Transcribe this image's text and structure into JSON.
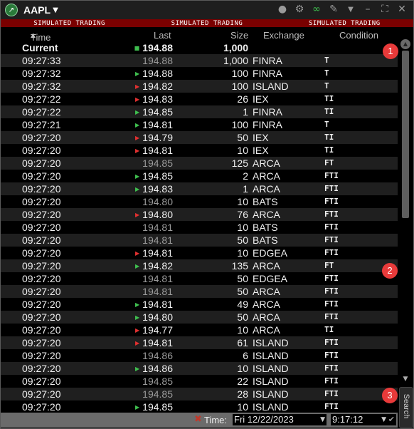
{
  "title": {
    "symbol": "AAPL",
    "app_icon": "tws-logo-icon"
  },
  "toolbar_icons": [
    "chat-icon",
    "gear-icon",
    "link-icon",
    "pin-icon",
    "caret-down-icon",
    "minimize-icon",
    "maximize-icon",
    "close-icon"
  ],
  "banner": [
    "SIMULATED TRADING",
    "SIMULATED TRADING",
    "SIMULATED TRADING"
  ],
  "columns": {
    "time": "Time",
    "last": "Last",
    "size": "Size",
    "exchange": "Exchange",
    "condition": "Condition"
  },
  "current": {
    "time": "Current",
    "last": "194.88",
    "size": "1,000"
  },
  "trades": [
    {
      "time": "09:27:33",
      "last": "194.88",
      "size": "1,000",
      "exchange": "FINRA",
      "condition": "T",
      "tick": "none"
    },
    {
      "time": "09:27:32",
      "last": "194.88",
      "size": "100",
      "exchange": "FINRA",
      "condition": "T",
      "tick": "up"
    },
    {
      "time": "09:27:32",
      "last": "194.82",
      "size": "100",
      "exchange": "ISLAND",
      "condition": "T",
      "tick": "down"
    },
    {
      "time": "09:27:22",
      "last": "194.83",
      "size": "26",
      "exchange": "IEX",
      "condition": "TI",
      "tick": "down"
    },
    {
      "time": "09:27:22",
      "last": "194.85",
      "size": "1",
      "exchange": "FINRA",
      "condition": "TI",
      "tick": "up"
    },
    {
      "time": "09:27:21",
      "last": "194.81",
      "size": "100",
      "exchange": "FINRA",
      "condition": "T",
      "tick": "up"
    },
    {
      "time": "09:27:20",
      "last": "194.79",
      "size": "50",
      "exchange": "IEX",
      "condition": "TI",
      "tick": "down"
    },
    {
      "time": "09:27:20",
      "last": "194.81",
      "size": "10",
      "exchange": "IEX",
      "condition": "TI",
      "tick": "down"
    },
    {
      "time": "09:27:20",
      "last": "194.85",
      "size": "125",
      "exchange": "ARCA",
      "condition": "FT",
      "tick": "none"
    },
    {
      "time": "09:27:20",
      "last": "194.85",
      "size": "2",
      "exchange": "ARCA",
      "condition": "FTI",
      "tick": "up"
    },
    {
      "time": "09:27:20",
      "last": "194.83",
      "size": "1",
      "exchange": "ARCA",
      "condition": "FTI",
      "tick": "up"
    },
    {
      "time": "09:27:20",
      "last": "194.80",
      "size": "10",
      "exchange": "BATS",
      "condition": "FTI",
      "tick": "none"
    },
    {
      "time": "09:27:20",
      "last": "194.80",
      "size": "76",
      "exchange": "ARCA",
      "condition": "FTI",
      "tick": "down"
    },
    {
      "time": "09:27:20",
      "last": "194.81",
      "size": "10",
      "exchange": "BATS",
      "condition": "FTI",
      "tick": "none"
    },
    {
      "time": "09:27:20",
      "last": "194.81",
      "size": "50",
      "exchange": "BATS",
      "condition": "FTI",
      "tick": "none"
    },
    {
      "time": "09:27:20",
      "last": "194.81",
      "size": "10",
      "exchange": "EDGEA",
      "condition": "FTI",
      "tick": "down"
    },
    {
      "time": "09:27:20",
      "last": "194.82",
      "size": "135",
      "exchange": "ARCA",
      "condition": "FT",
      "tick": "up"
    },
    {
      "time": "09:27:20",
      "last": "194.81",
      "size": "50",
      "exchange": "EDGEA",
      "condition": "FTI",
      "tick": "none"
    },
    {
      "time": "09:27:20",
      "last": "194.81",
      "size": "50",
      "exchange": "ARCA",
      "condition": "FTI",
      "tick": "none"
    },
    {
      "time": "09:27:20",
      "last": "194.81",
      "size": "49",
      "exchange": "ARCA",
      "condition": "FTI",
      "tick": "up"
    },
    {
      "time": "09:27:20",
      "last": "194.80",
      "size": "50",
      "exchange": "ARCA",
      "condition": "FTI",
      "tick": "up"
    },
    {
      "time": "09:27:20",
      "last": "194.77",
      "size": "10",
      "exchange": "ARCA",
      "condition": "TI",
      "tick": "down"
    },
    {
      "time": "09:27:20",
      "last": "194.81",
      "size": "61",
      "exchange": "ISLAND",
      "condition": "FTI",
      "tick": "down"
    },
    {
      "time": "09:27:20",
      "last": "194.86",
      "size": "6",
      "exchange": "ISLAND",
      "condition": "FTI",
      "tick": "none"
    },
    {
      "time": "09:27:20",
      "last": "194.86",
      "size": "10",
      "exchange": "ISLAND",
      "condition": "FTI",
      "tick": "up"
    },
    {
      "time": "09:27:20",
      "last": "194.85",
      "size": "22",
      "exchange": "ISLAND",
      "condition": "FTI",
      "tick": "none"
    },
    {
      "time": "09:27:20",
      "last": "194.85",
      "size": "28",
      "exchange": "ISLAND",
      "condition": "FTI",
      "tick": "none"
    },
    {
      "time": "09:27:20",
      "last": "194.85",
      "size": "10",
      "exchange": "ISLAND",
      "condition": "FTI",
      "tick": "up"
    }
  ],
  "search_tab": "Search",
  "footer": {
    "time_label": "Time:",
    "date_value": "Fri 12/22/2023",
    "time_value": "9:17:12"
  },
  "badges": [
    "1",
    "2",
    "3"
  ],
  "colors": {
    "banner": "#7a0000",
    "up": "#3fbf4f",
    "down": "#e03030",
    "badge": "#e83a3a"
  }
}
